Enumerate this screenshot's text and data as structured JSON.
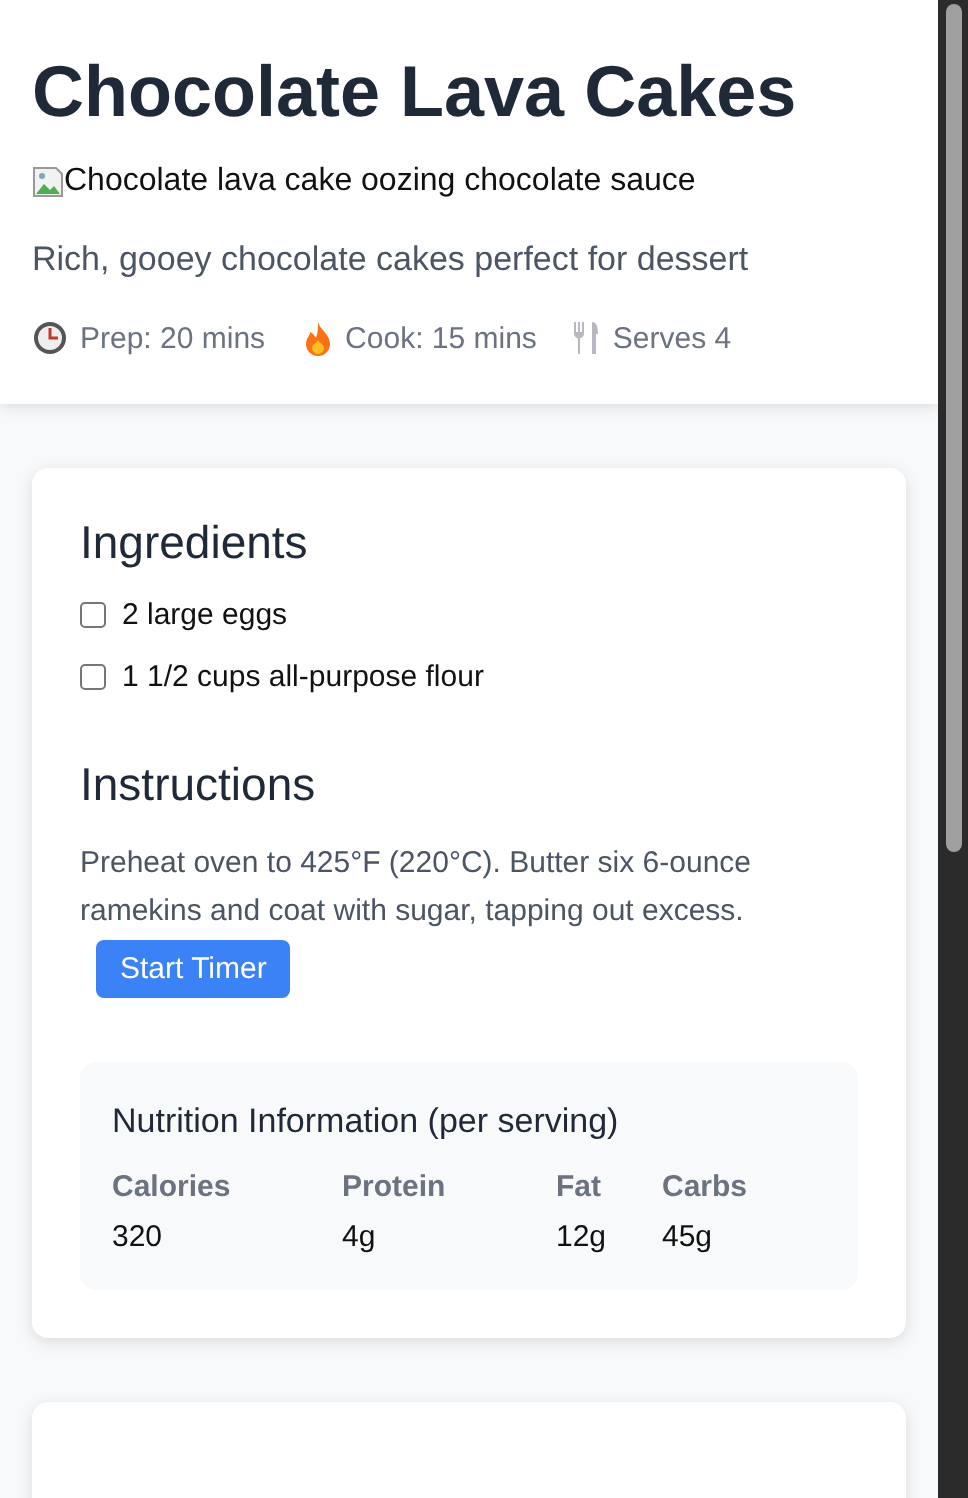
{
  "recipe": {
    "title": "Chocolate Lava Cakes",
    "image": {
      "kind": "broken",
      "alt": "Chocolate lava cake oozing chocolate sauce"
    },
    "description": "Rich, gooey chocolate cakes perfect for dessert",
    "meta": [
      {
        "kind": "clock",
        "text": "Prep: 20 mins"
      },
      {
        "kind": "fire",
        "text": "Cook: 15 mins"
      },
      {
        "kind": "utensils",
        "text": "Serves 4"
      }
    ]
  },
  "ingredients": {
    "heading": "Ingredients",
    "items": [
      {
        "text": "2 large eggs",
        "checked": false
      },
      {
        "text": "1 1/2 cups all-purpose flour",
        "checked": false
      }
    ]
  },
  "instructions": {
    "heading": "Instructions",
    "text": "Preheat oven to 425°F (220°C). Butter six 6-ounce ramekins and coat with sugar, tapping out excess.",
    "button": "Start Timer"
  },
  "nutrition": {
    "heading": "Nutrition Information (per serving)",
    "columns": [
      "Calories",
      "Protein",
      "Fat",
      "Carbs"
    ],
    "values": [
      "320",
      "4g",
      "12g",
      "45g"
    ]
  }
}
